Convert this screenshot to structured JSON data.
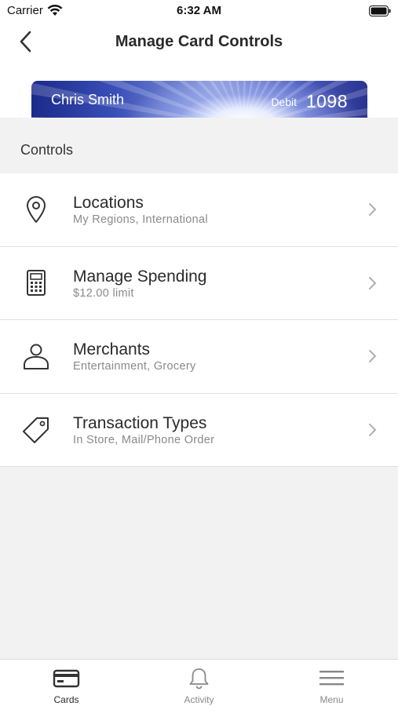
{
  "status_bar": {
    "carrier": "Carrier",
    "time": "6:32 AM"
  },
  "nav": {
    "title": "Manage Card Controls",
    "back_icon": "chevron-left-icon"
  },
  "card": {
    "holder": "Chris Smith",
    "type": "Debit",
    "number": "1098"
  },
  "section": {
    "title": "Controls"
  },
  "controls": [
    {
      "title": "Locations",
      "subtitle": "My Regions, International",
      "icon": "location-pin-icon"
    },
    {
      "title": "Manage Spending",
      "subtitle": "$12.00 limit",
      "icon": "calculator-icon"
    },
    {
      "title": "Merchants",
      "subtitle": "Entertainment, Grocery",
      "icon": "person-icon"
    },
    {
      "title": "Transaction Types",
      "subtitle": "In Store, Mail/Phone Order",
      "icon": "tag-icon"
    }
  ],
  "tabs": [
    {
      "label": "Cards",
      "icon": "credit-card-icon",
      "active": true
    },
    {
      "label": "Activity",
      "icon": "bell-icon",
      "active": false
    },
    {
      "label": "Menu",
      "icon": "menu-icon",
      "active": false
    }
  ],
  "colors": {
    "background": "#f2f2f2",
    "card_blue": "#2a3490",
    "text_primary": "#2a2a2a",
    "text_secondary": "#8a8a8a"
  }
}
